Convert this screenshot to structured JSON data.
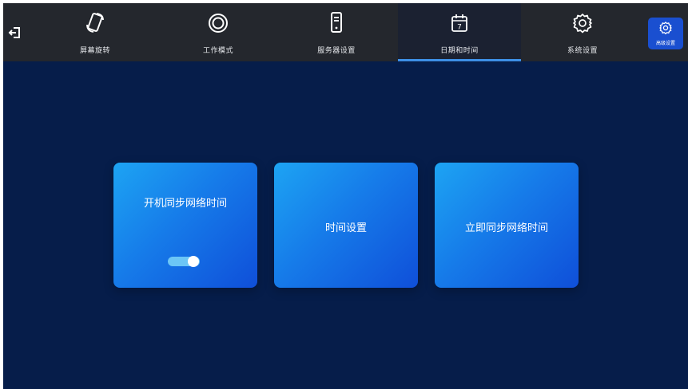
{
  "topbar": {
    "back_icon": "exit-arrow-icon",
    "tabs": [
      {
        "label": "屏幕旋转",
        "icon": "screen-rotation-icon"
      },
      {
        "label": "工作模式",
        "icon": "ring-icon"
      },
      {
        "label": "服务器设置",
        "icon": "server-icon"
      },
      {
        "label": "日期和时间",
        "icon": "calendar-icon",
        "active": true,
        "calendar_day": "7"
      },
      {
        "label": "系统设置",
        "icon": "gear-icon"
      }
    ],
    "advanced": {
      "label": "高级设置",
      "icon": "gear-icon"
    }
  },
  "cards": [
    {
      "title": "开机同步网络时间",
      "toggle_on": true
    },
    {
      "title": "时间设置"
    },
    {
      "title": "立即同步网络时间"
    }
  ],
  "colors": {
    "background": "#061d4a",
    "topbar": "#24272d",
    "active_tab": "#1b2131",
    "accent": "#3d8fe6",
    "advanced_button": "#1a4fd0"
  }
}
